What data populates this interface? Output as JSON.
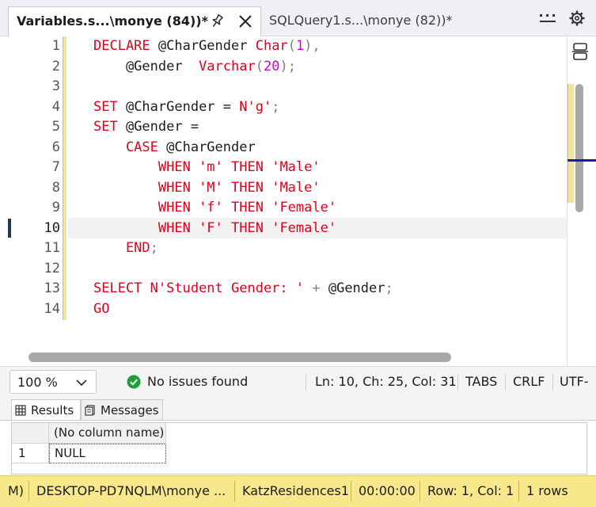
{
  "tabs": [
    {
      "label": "Variables.s...\\monye (84))*",
      "active": true
    },
    {
      "label": "SQLQuery1.s...\\monye (82))*",
      "active": false
    }
  ],
  "editor": {
    "line_numbers": [
      "1",
      "2",
      "3",
      "4",
      "5",
      "6",
      "7",
      "8",
      "9",
      "10",
      "11",
      "12",
      "13",
      "14"
    ],
    "current_line": "10",
    "lines": [
      [
        [
          "kw",
          "DECLARE "
        ],
        [
          "id",
          "@CharGender "
        ],
        [
          "kw",
          "Char"
        ],
        [
          "punct",
          "("
        ],
        [
          "num",
          "1"
        ],
        [
          "punct",
          "),"
        ]
      ],
      [
        [
          "id",
          "    @Gender  "
        ],
        [
          "kw",
          "Varchar"
        ],
        [
          "punct",
          "("
        ],
        [
          "num",
          "20"
        ],
        [
          "punct",
          ");"
        ]
      ],
      [],
      [
        [
          "kw",
          "SET "
        ],
        [
          "id",
          "@CharGender = "
        ],
        [
          "str",
          "N'g'"
        ],
        [
          "punct",
          ";"
        ]
      ],
      [
        [
          "kw",
          "SET "
        ],
        [
          "id",
          "@Gender ="
        ]
      ],
      [
        [
          "kw",
          "    CASE "
        ],
        [
          "id",
          "@CharGender"
        ]
      ],
      [
        [
          "kw",
          "        WHEN "
        ],
        [
          "str",
          "'m' "
        ],
        [
          "kw",
          "THEN "
        ],
        [
          "str",
          "'Male'"
        ]
      ],
      [
        [
          "kw",
          "        WHEN "
        ],
        [
          "str",
          "'M' "
        ],
        [
          "kw",
          "THEN "
        ],
        [
          "str",
          "'Male'"
        ]
      ],
      [
        [
          "kw",
          "        WHEN "
        ],
        [
          "str",
          "'f' "
        ],
        [
          "kw",
          "THEN "
        ],
        [
          "str",
          "'Female'"
        ]
      ],
      [
        [
          "kw",
          "        WHEN "
        ],
        [
          "str",
          "'F' "
        ],
        [
          "kw",
          "THEN "
        ],
        [
          "str",
          "'Female'"
        ]
      ],
      [
        [
          "kw",
          "    END"
        ],
        [
          "punct",
          ";"
        ]
      ],
      [],
      [
        [
          "kw",
          "SELECT "
        ],
        [
          "str",
          "N'Student Gender: ' "
        ],
        [
          "punct",
          "+ "
        ],
        [
          "id",
          "@Gender"
        ],
        [
          "punct",
          ";"
        ]
      ],
      [
        [
          "kw",
          "GO"
        ]
      ]
    ]
  },
  "status": {
    "zoom": "100 %",
    "issues": "No issues found",
    "position": "Ln: 10, Ch: 25, Col: 31",
    "indent": "TABS",
    "line_ending": "CRLF",
    "encoding": "UTF-"
  },
  "results": {
    "tab_results": "Results",
    "tab_messages": "Messages",
    "column_header": "(No column name)",
    "row_number": "1",
    "cell_value": "NULL"
  },
  "connection": {
    "mode_fragment": "M)",
    "server_user": "DESKTOP-PD7NQLM\\monye ...",
    "database": "KatzResidences1",
    "elapsed": "00:00:00",
    "cursor": "Row: 1, Col: 1",
    "row_count": "1 rows"
  },
  "colors": {
    "keyword": "#e0001c",
    "number": "#d000c8",
    "connection_bar": "#f7e98b",
    "ok_check": "#1e9e3a"
  }
}
